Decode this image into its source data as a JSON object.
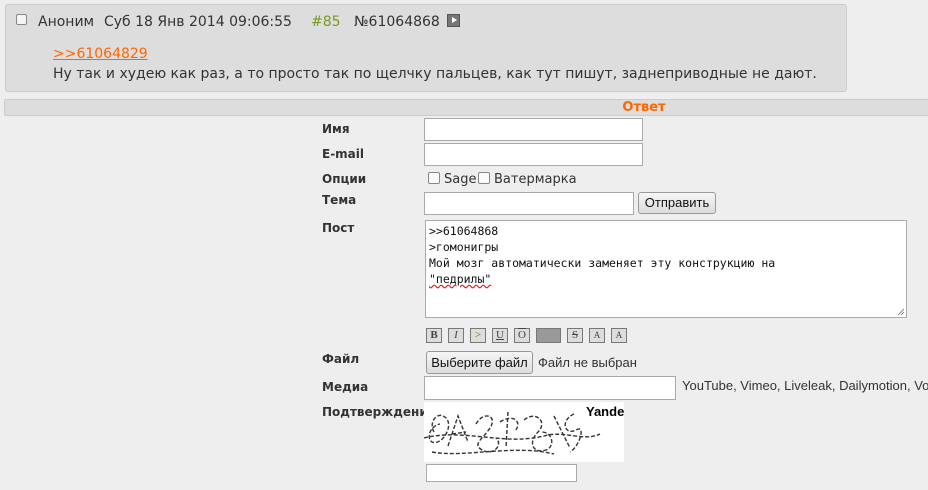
{
  "post": {
    "author": "Аноним",
    "date": "Суб 18 Янв 2014 09:06:55",
    "index": "#85",
    "number": "№61064868",
    "reply_link": ">>61064829",
    "text": "Ну так и худею как раз, а то просто так по щелчку пальцев, как тут пишут,  заднеприводные не дают."
  },
  "form": {
    "title": "Ответ",
    "name_label": "Имя",
    "email_label": "E-mail",
    "options_label": "Опции",
    "sage_label": "Sage",
    "watermark_label": "Ватермарка",
    "subject_label": "Тема",
    "submit_label": "Отправить",
    "post_label": "Пост",
    "post_lines": [
      ">>61064868",
      ">гомонигры",
      "Мой мозг автоматически заменяет эту конструкцию на",
      "\"педрилы\""
    ],
    "format_buttons": [
      "B",
      "I",
      ">",
      "U",
      "O",
      "S",
      "A",
      "A"
    ],
    "file_label": "Файл",
    "file_button": "Выберите файл",
    "file_status": "Файл не выбран",
    "media_label": "Медиа",
    "media_hint": "YouTube, Vimeo, Liveleak, Dailymotion, Vo",
    "captcha_label": "Подтверждение",
    "captcha_brand": "Yandex"
  },
  "colors": {
    "accent": "#ff6600",
    "post_bg": "#dddddd",
    "page_bg": "#eeeeee",
    "greentext": "#789922"
  }
}
